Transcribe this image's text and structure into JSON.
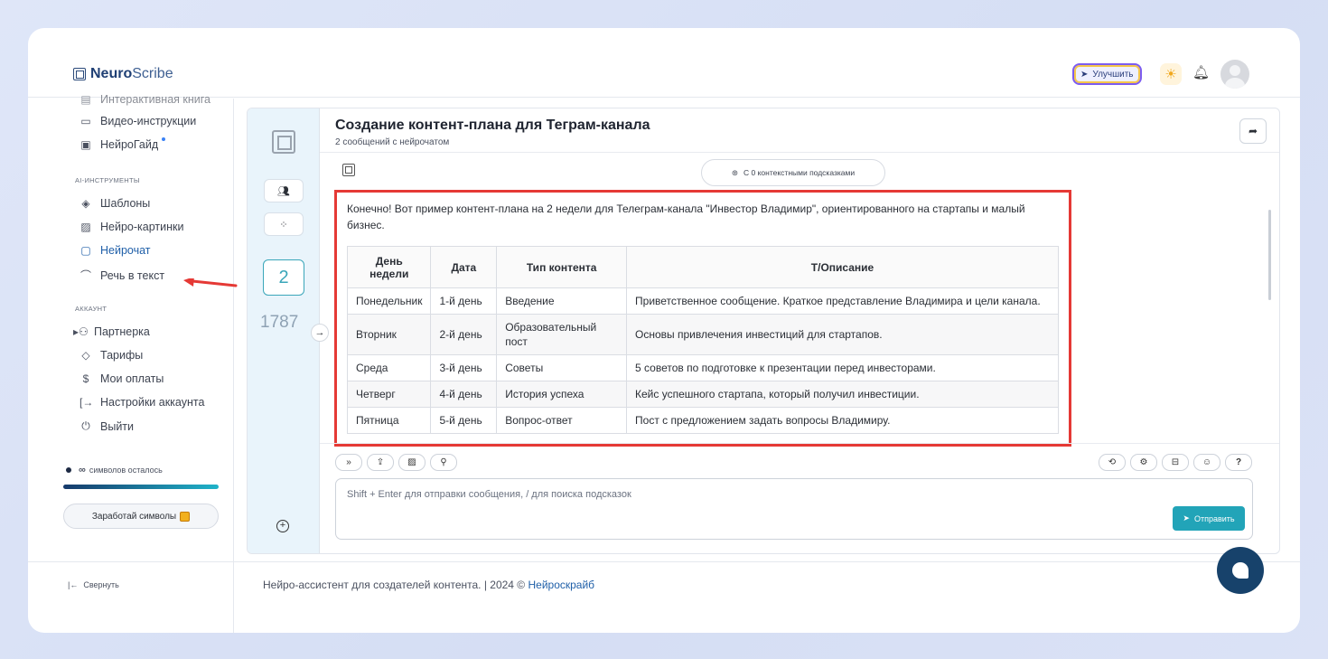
{
  "app": {
    "name_bold": "Neuro",
    "name_light": "Scribe"
  },
  "header": {
    "upgrade_label": "Улучшить"
  },
  "sidebar": {
    "items_top": [
      {
        "label": "Интерактивная книга",
        "icon": "book-icon"
      },
      {
        "label": "Видео-инструкции",
        "icon": "video-icon"
      },
      {
        "label": "НейроГайд",
        "icon": "guide-icon"
      }
    ],
    "section_ai": "AI-ИНСТРУМЕНТЫ",
    "items_ai": [
      {
        "label": "Шаблоны",
        "icon": "templates-icon"
      },
      {
        "label": "Нейро-картинки",
        "icon": "image-icon"
      },
      {
        "label": "Нейрочат",
        "icon": "chat-icon",
        "active": true
      },
      {
        "label": "Речь в текст",
        "icon": "headphones-icon"
      }
    ],
    "section_account": "АККАУНТ",
    "items_account": [
      {
        "label": "Партнерка",
        "icon": "partners-icon"
      },
      {
        "label": "Тарифы",
        "icon": "tag-icon"
      },
      {
        "label": "Мои оплаты",
        "icon": "dollar-icon"
      },
      {
        "label": "Настройки аккаунта",
        "icon": "settings-exit-icon"
      },
      {
        "label": "Выйти",
        "icon": "power-icon"
      }
    ],
    "symbols_value": "∞",
    "symbols_label": "символов осталось",
    "symbols_fill": 1.0,
    "earn_label": "Заработай символы",
    "collapse_label": "Свернуть"
  },
  "rail": {
    "dialog_count": "2",
    "counter": "1787"
  },
  "chat": {
    "title": "Создание контент-плана для Теграм-канала",
    "subtitle": "2 сообщений с нейрочатом",
    "hints_label": "С 0 контекстными подсказками",
    "message_intro": "Конечно! Вот пример контент-плана на 2 недели для Телеграм-канала \"Инвестор Владимир\", ориентированного на стартапы и малый бизнес.",
    "table": {
      "headers": [
        "День недели",
        "Дата",
        "Тип контента",
        "Т/Описание"
      ],
      "rows": [
        [
          "Понедельник",
          "1-й день",
          "Введение",
          "Приветственное сообщение. Краткое представление Владимира и цели канала."
        ],
        [
          "Вторник",
          "2-й день",
          "Образовательный пост",
          "Основы привлечения инвестиций для стартапов."
        ],
        [
          "Среда",
          "3-й день",
          "Советы",
          "5 советов по подготовке к презентации перед инвесторами."
        ],
        [
          "Четверг",
          "4-й день",
          "История успеха",
          "Кейс успешного стартапа, который получил инвестиции."
        ],
        [
          "Пятница",
          "5-й день",
          "Вопрос-ответ",
          "Пост с предложением задать вопросы Владимиру."
        ]
      ]
    },
    "input_placeholder": "Shift + Enter для отправки сообщения, / для поиска подсказок",
    "send_label": "Отправить"
  },
  "footer": {
    "text": "Нейро-ассистент для создателей контента.  | 2024 © ",
    "link": "Нейроскрайб"
  },
  "colors": {
    "accent": "#22a4b8",
    "highlight": "#e53935",
    "brand_dark": "#17426b"
  }
}
